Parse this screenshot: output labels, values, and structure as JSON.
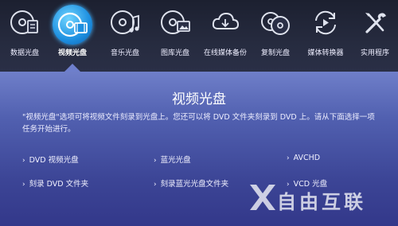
{
  "nav": {
    "tabs": [
      {
        "label": "数据光盘",
        "icon": "data-disc-icon"
      },
      {
        "label": "视频光盘",
        "icon": "video-disc-icon"
      },
      {
        "label": "音乐光盘",
        "icon": "music-disc-icon"
      },
      {
        "label": "图库光盘",
        "icon": "photo-disc-icon"
      },
      {
        "label": "在线媒体备份",
        "icon": "cloud-backup-icon"
      },
      {
        "label": "复制光盘",
        "icon": "copy-disc-icon"
      },
      {
        "label": "媒体转换器",
        "icon": "media-converter-icon"
      },
      {
        "label": "实用程序",
        "icon": "tools-icon"
      }
    ],
    "active_index": 1
  },
  "main": {
    "title": "视频光盘",
    "description": "\"视频光盘\"选项可将视频文件刻录到光盘上。您还可以将 DVD 文件夹刻录到 DVD 上。请从下面选择一项任务开始进行。",
    "options": [
      {
        "label": "DVD 视频光盘"
      },
      {
        "label": "蓝光光盘"
      },
      {
        "label": "AVCHD"
      },
      {
        "label": "刻录 DVD 文件夹"
      },
      {
        "label": "刻录蓝光光盘文件夹"
      },
      {
        "label": "VCD 光盘"
      }
    ]
  },
  "watermark": {
    "text": "自由互联"
  },
  "colors": {
    "accent": "#1d8fe0",
    "topbar": "#1c2030",
    "panel": "#5160b0"
  }
}
